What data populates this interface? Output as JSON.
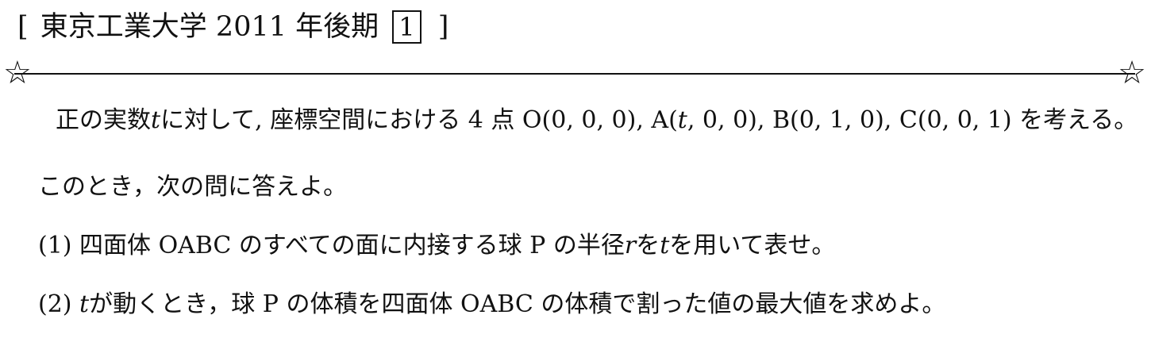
{
  "header": {
    "open_bracket": "[",
    "title": "東京工業大学 2011 年後期",
    "problem_number": "1",
    "close_bracket": "]"
  },
  "icons": {
    "star": "☆"
  },
  "problem": {
    "intro_line1": {
      "a": "正の実数",
      "var_t": "t",
      "b": "に対して, 座標空間における 4 点 O(0, 0, 0), A(",
      "var_t2": "t",
      "c": ", 0, 0), B(0, 1, 0), C(0, 0, 1) を考える。"
    },
    "intro_line2": "このとき，次の問に答えよ。",
    "q1": {
      "a": "(1)  四面体 OABC のすべての面に内接する球 P の半径",
      "var_r": "r",
      "b": "を",
      "var_t": "t",
      "c": "を用いて表せ。"
    },
    "q2": {
      "a": "(2)  ",
      "var_t": "t",
      "b": "が動くとき，球 P の体積を四面体 OABC の体積で割った値の最大値を求めよ。"
    }
  }
}
